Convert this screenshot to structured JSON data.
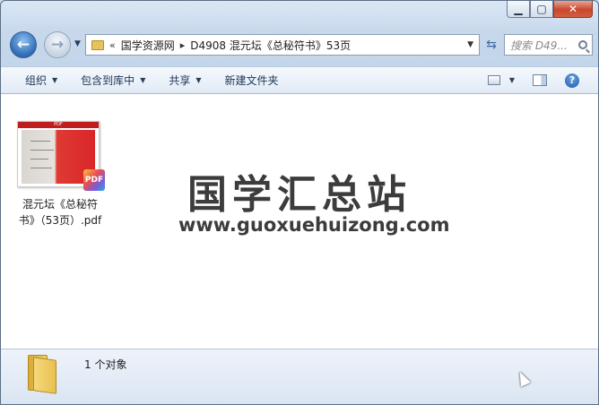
{
  "address_bar": {
    "overflow": "«",
    "crumbs": [
      "国学资源网",
      "D4908 混元坛《总秘符书》53页"
    ]
  },
  "search": {
    "placeholder": "搜索 D49..."
  },
  "toolbar": {
    "organize": "组织",
    "include_in_library": "包含到库中",
    "share": "共享",
    "new_folder": "新建文件夹"
  },
  "file": {
    "name_line1": "混元坛《总秘符",
    "name_line2": "书》（53页）.pdf",
    "badge": "PDF",
    "thumb_label": "PDF"
  },
  "watermark": {
    "title": "国学汇总站",
    "url": "www.guoxuehuizong.com"
  },
  "status": {
    "count": "1 个对象"
  },
  "icons": {
    "back": "back-arrow-icon",
    "forward": "forward-arrow-icon",
    "refresh": "refresh-icon",
    "help": "help-icon"
  },
  "colors": {
    "accent": "#2d6bb5",
    "close": "#c8472d",
    "toolbar_text": "#1e3657"
  }
}
